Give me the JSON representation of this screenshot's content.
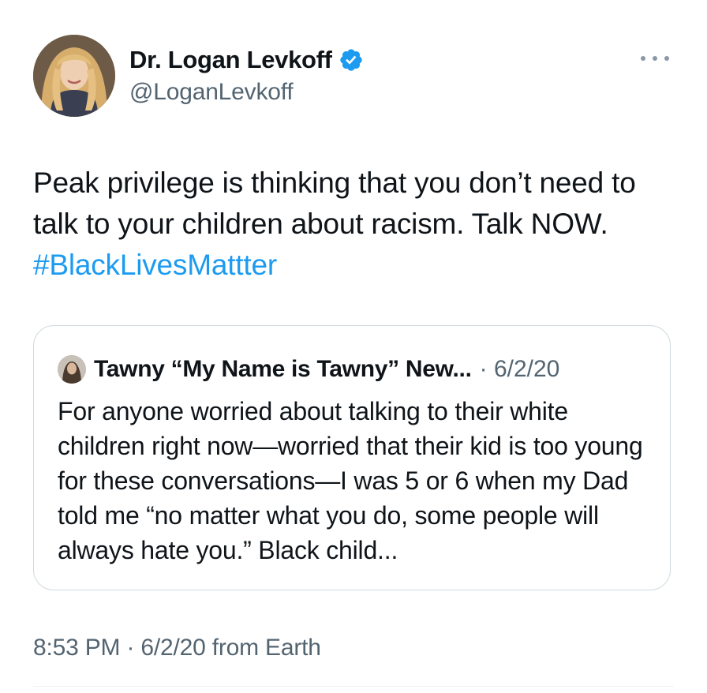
{
  "author": {
    "display_name": "Dr. Logan Levkoff",
    "handle": "@LoganLevkoff",
    "verified_icon": "verified-badge-icon"
  },
  "tweet": {
    "text": "Peak privilege is thinking that you don’t need to talk to your children about racism. Talk NOW. ",
    "hashtag": "#BlackLivesMattter",
    "timestamp": "8:53 PM · 6/2/20 from Earth"
  },
  "quoted_tweet": {
    "author_name": "Tawny “My Name is Tawny” New...",
    "separator": " · ",
    "date": "6/2/20",
    "text": "For anyone worried about talking to their white children right now—worried that their kid is too young for these conversations—I was 5 or 6 when my Dad told me “no matter what you do, some people will always hate you.”  Black child..."
  },
  "colors": {
    "text": "#0f1419",
    "secondary": "#536471",
    "link": "#1d9bf0",
    "border": "#cfd9de"
  }
}
